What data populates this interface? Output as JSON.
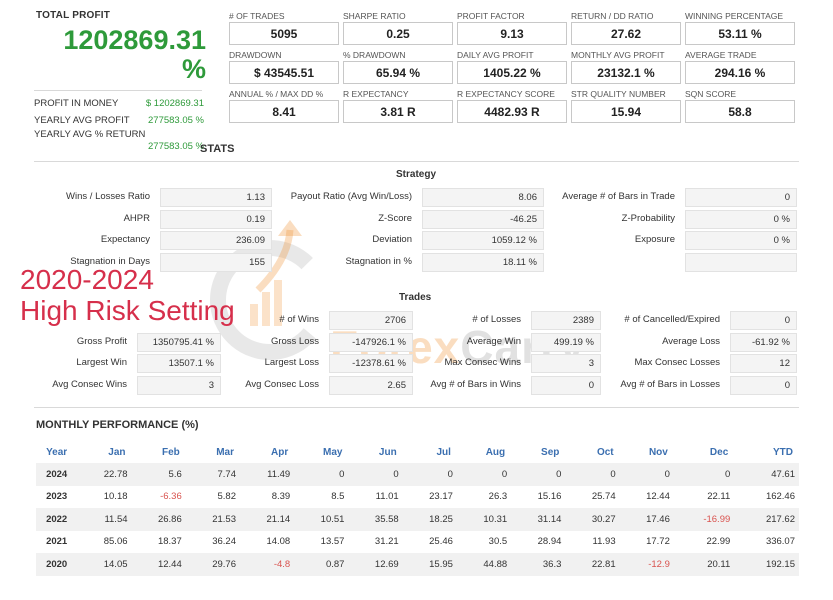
{
  "summary": {
    "total_profit_label": "TOTAL PROFIT",
    "total_profit_value": "1202869.31",
    "total_profit_unit": "%",
    "side": [
      {
        "label": "PROFIT IN MONEY",
        "value": "$ 1202869.31"
      },
      {
        "label": "YEARLY AVG PROFIT",
        "value": "277583.05 %"
      },
      {
        "label": "YEARLY AVG % RETURN",
        "value": "277583.05 %"
      }
    ],
    "stats_title": "STATS"
  },
  "kpis": [
    {
      "label": "# OF TRADES",
      "value": "5095"
    },
    {
      "label": "SHARPE RATIO",
      "value": "0.25"
    },
    {
      "label": "PROFIT FACTOR",
      "value": "9.13"
    },
    {
      "label": "RETURN / DD RATIO",
      "value": "27.62"
    },
    {
      "label": "WINNING PERCENTAGE",
      "value": "53.11 %"
    },
    {
      "label": "DRAWDOWN",
      "value": "$ 43545.51"
    },
    {
      "label": "% DRAWDOWN",
      "value": "65.94 %"
    },
    {
      "label": "DAILY AVG PROFIT",
      "value": "1405.22 %"
    },
    {
      "label": "MONTHLY AVG PROFIT",
      "value": "23132.1 %"
    },
    {
      "label": "AVERAGE TRADE",
      "value": "294.16 %"
    },
    {
      "label": "ANNUAL % / MAX DD %",
      "value": "8.41"
    },
    {
      "label": "R EXPECTANCY",
      "value": "3.81 R"
    },
    {
      "label": "R EXPECTANCY SCORE",
      "value": "4482.93 R"
    },
    {
      "label": "STR QUALITY NUMBER",
      "value": "15.94"
    },
    {
      "label": "SQN SCORE",
      "value": "58.8"
    }
  ],
  "strategy": {
    "title": "Strategy",
    "rows": [
      [
        {
          "label": "Wins / Losses Ratio",
          "value": "1.13"
        },
        {
          "label": "Payout Ratio (Avg Win/Loss)",
          "value": "8.06"
        },
        {
          "label": "Average # of Bars in Trade",
          "value": "0"
        }
      ],
      [
        {
          "label": "AHPR",
          "value": "0.19"
        },
        {
          "label": "Z-Score",
          "value": "-46.25"
        },
        {
          "label": "Z-Probability",
          "value": "0 %"
        }
      ],
      [
        {
          "label": "Expectancy",
          "value": "236.09"
        },
        {
          "label": "Deviation",
          "value": "1059.12 %"
        },
        {
          "label": "Exposure",
          "value": "0 %"
        }
      ],
      [
        {
          "label": "Stagnation in Days",
          "value": "155"
        },
        {
          "label": "Stagnation in %",
          "value": "18.11 %"
        },
        {
          "label": "",
          "value": ""
        }
      ]
    ]
  },
  "trades": {
    "title": "Trades",
    "rows": [
      [
        {
          "label": "",
          "value": ""
        },
        {
          "label": "# of Wins",
          "value": "2706"
        },
        {
          "label": "# of Losses",
          "value": "2389"
        },
        {
          "label": "# of Cancelled/Expired",
          "value": "0"
        }
      ],
      [
        {
          "label": "Gross Profit",
          "value": "1350795.41 %"
        },
        {
          "label": "Gross Loss",
          "value": "-147926.1 %"
        },
        {
          "label": "Average Win",
          "value": "499.19 %"
        },
        {
          "label": "Average Loss",
          "value": "-61.92 %"
        }
      ],
      [
        {
          "label": "Largest Win",
          "value": "13507.1 %"
        },
        {
          "label": "Largest Loss",
          "value": "-12378.61 %"
        },
        {
          "label": "Max Consec Wins",
          "value": "3"
        },
        {
          "label": "Max Consec Losses",
          "value": "12"
        }
      ],
      [
        {
          "label": "Avg Consec Wins",
          "value": "3"
        },
        {
          "label": "Avg Consec Loss",
          "value": "2.65"
        },
        {
          "label": "Avg # of Bars in Wins",
          "value": "0"
        },
        {
          "label": "Avg # of Bars in Losses",
          "value": "0"
        }
      ]
    ]
  },
  "overlay": {
    "line1": "2020-2024",
    "line2": "High Risk Setting"
  },
  "watermark": {
    "part1": "Forex",
    "part2": "Carry"
  },
  "monthly": {
    "title": "MONTHLY PERFORMANCE (%)",
    "headers": [
      "Year",
      "Jan",
      "Feb",
      "Mar",
      "Apr",
      "May",
      "Jun",
      "Jul",
      "Aug",
      "Sep",
      "Oct",
      "Nov",
      "Dec",
      "YTD"
    ],
    "rows": [
      [
        "2024",
        "22.78",
        "5.6",
        "7.74",
        "11.49",
        "0",
        "0",
        "0",
        "0",
        "0",
        "0",
        "0",
        "0",
        "47.61"
      ],
      [
        "2023",
        "10.18",
        "-6.36",
        "5.82",
        "8.39",
        "8.5",
        "11.01",
        "23.17",
        "26.3",
        "15.16",
        "25.74",
        "12.44",
        "22.11",
        "162.46"
      ],
      [
        "2022",
        "11.54",
        "26.86",
        "21.53",
        "21.14",
        "10.51",
        "35.58",
        "18.25",
        "10.31",
        "31.14",
        "30.27",
        "17.46",
        "-16.99",
        "217.62"
      ],
      [
        "2021",
        "85.06",
        "18.37",
        "36.24",
        "14.08",
        "13.57",
        "31.21",
        "25.46",
        "30.5",
        "28.94",
        "11.93",
        "17.72",
        "22.99",
        "336.07"
      ],
      [
        "2020",
        "14.05",
        "12.44",
        "29.76",
        "-4.8",
        "0.87",
        "12.69",
        "15.95",
        "44.88",
        "36.3",
        "22.81",
        "-12.9",
        "20.11",
        "192.15"
      ]
    ]
  },
  "colors": {
    "profit_green": "#2e9a3a",
    "header_blue": "#3b6fb0",
    "negative_red": "#d9534f",
    "overlay_red": "#d62f4b"
  }
}
